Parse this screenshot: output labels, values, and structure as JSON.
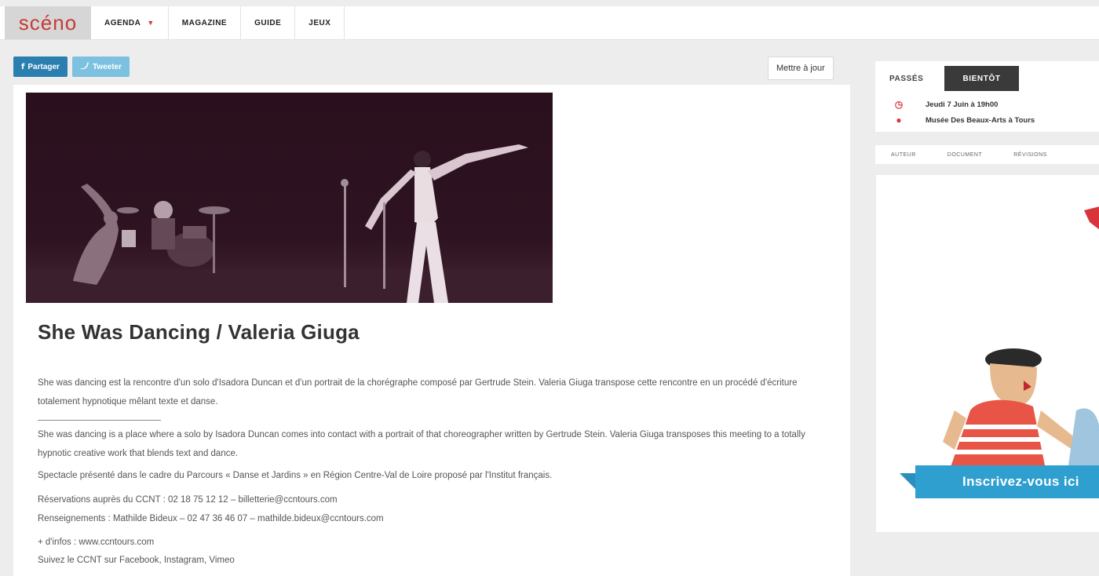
{
  "brand": {
    "logo_text": "scéno",
    "accent": "#c83a34"
  },
  "nav": {
    "items": [
      {
        "label": "AGENDA",
        "has_dropdown": true
      },
      {
        "label": "MAGAZINE"
      },
      {
        "label": "GUIDE"
      },
      {
        "label": "JEUX"
      }
    ],
    "dropdown_icon": "triangle-down-icon"
  },
  "share": {
    "facebook_label": "Partager",
    "twitter_label": "Tweeter",
    "facebook_color": "#2b7fb0",
    "twitter_color": "#7cc1df"
  },
  "update_button": "Mettre à jour",
  "event": {
    "title": "She Was Dancing / Valeria Giuga",
    "desc_fr": "She was dancing est la rencontre d'un solo d'Isadora Duncan et d'un portrait de la chorégraphe composé par Gertrude Stein. Valeria Giuga transpose cette rencontre en un procédé d'écriture totalement hypnotique mêlant texte et danse.",
    "desc_en": "She was dancing is a place where a solo by Isadora Duncan comes into contact with a portrait of that choreographer written by Gertrude Stein. Valeria Giuga transposes this meeting to a totally hypnotic creative work that blends text and dance.",
    "context": "Spectacle présenté dans le cadre du Parcours « Danse et Jardins » en Région Centre-Val de Loire proposé par l'Institut français.",
    "reservations": "Réservations auprès du CCNT : 02 18 75 12 12 – billetterie@ccntours.com",
    "renseignements": "Renseignements : Mathilde Bideux – 02 47 36 46 07 – mathilde.bideux@ccntours.com",
    "plus_infos": "+ d'infos : www.ccntours.com",
    "follow": "Suivez le CCNT sur Facebook, Instagram, Vimeo"
  },
  "sidebar": {
    "tabs": [
      "PASSÉS",
      "BIENTÔT"
    ],
    "active_tab": "BIENTÔT",
    "date": "Jeudi 7 Juin à 19h00",
    "place": "Musée Des Beaux-Arts à Tours",
    "date_icon": "clock-icon",
    "place_icon": "map-pin-icon",
    "sub_tabs": [
      "AUTEUR",
      "DOCUMENT",
      "RÉVISIONS"
    ],
    "ad_banner": "Inscrivez-vous ici"
  }
}
